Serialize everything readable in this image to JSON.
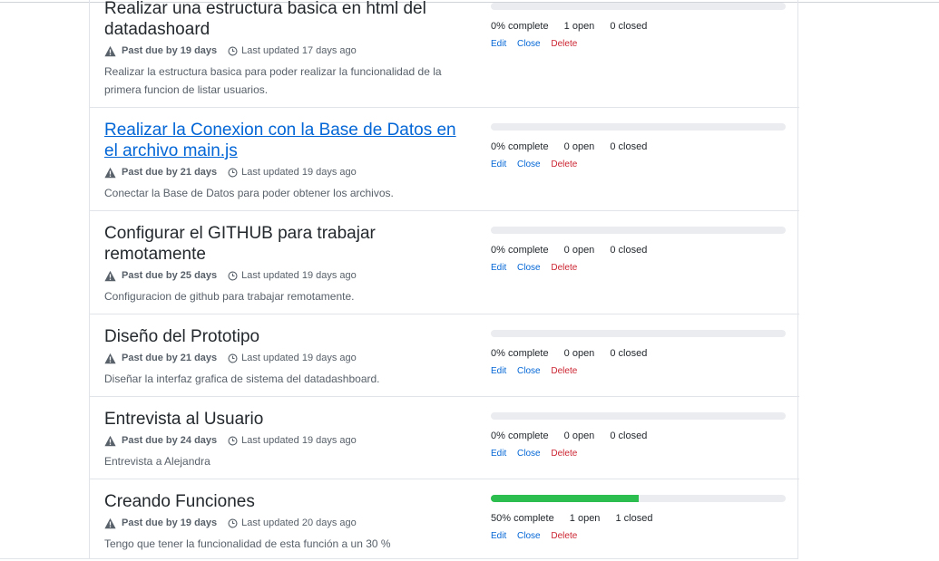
{
  "milestones": [
    {
      "title": "Realizar una estructura basica en html del datadashoard",
      "link_style": false,
      "due_label": "Past due by 19 days",
      "updated_label": "Last updated 17 days ago",
      "description": "Realizar la estructura basica para poder realizar la funcionalidad de la primera funcion de listar usuarios.",
      "progress_percent": 0,
      "complete_label": "0% complete",
      "open_label": "1 open",
      "closed_label": "0 closed"
    },
    {
      "title": "Realizar la Conexion con la Base de Datos en el archivo main.js",
      "link_style": true,
      "due_label": "Past due by 21 days",
      "updated_label": "Last updated 19 days ago",
      "description": "Conectar la Base de Datos para poder obtener los archivos.",
      "progress_percent": 0,
      "complete_label": "0% complete",
      "open_label": "0 open",
      "closed_label": "0 closed"
    },
    {
      "title": "Configurar el GITHUB para trabajar remotamente",
      "link_style": false,
      "due_label": "Past due by 25 days",
      "updated_label": "Last updated 19 days ago",
      "description": "Configuracion de github para trabajar remotamente.",
      "progress_percent": 0,
      "complete_label": "0% complete",
      "open_label": "0 open",
      "closed_label": "0 closed"
    },
    {
      "title": "Diseño del Prototipo",
      "link_style": false,
      "due_label": "Past due by 21 days",
      "updated_label": "Last updated 19 days ago",
      "description": "Diseñar la interfaz grafica de sistema del datadashboard.",
      "progress_percent": 0,
      "complete_label": "0% complete",
      "open_label": "0 open",
      "closed_label": "0 closed"
    },
    {
      "title": "Entrevista al Usuario",
      "link_style": false,
      "due_label": "Past due by 24 days",
      "updated_label": "Last updated 19 days ago",
      "description": "Entrevista a Alejandra",
      "progress_percent": 0,
      "complete_label": "0% complete",
      "open_label": "0 open",
      "closed_label": "0 closed"
    },
    {
      "title": "Creando Funciones",
      "link_style": false,
      "due_label": "Past due by 19 days",
      "updated_label": "Last updated 20 days ago",
      "description": "Tengo que tener la funcionalidad de esta función a un 30 %",
      "progress_percent": 50,
      "complete_label": "50% complete",
      "open_label": "1 open",
      "closed_label": "1 closed"
    }
  ],
  "actions": {
    "edit": "Edit",
    "close": "Close",
    "delete": "Delete"
  },
  "icons": {
    "due": "alert-icon",
    "updated": "clock-icon"
  },
  "colors": {
    "progress_fill": "#2cbe4e",
    "progress_track": "#eaecef",
    "link": "#0366d6",
    "danger": "#cb2431"
  }
}
